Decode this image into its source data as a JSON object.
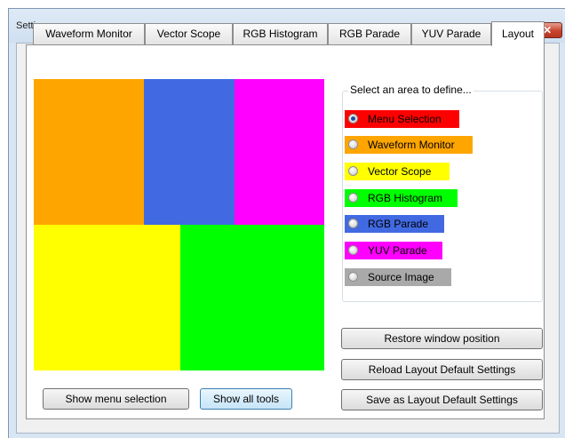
{
  "window": {
    "title": "Settings",
    "close_glyph": "✕"
  },
  "tabs": [
    {
      "label": "Waveform Monitor"
    },
    {
      "label": "Vector Scope"
    },
    {
      "label": "RGB Histogram"
    },
    {
      "label": "RGB Parade"
    },
    {
      "label": "YUV Parade"
    },
    {
      "label": "Layout",
      "active": true
    }
  ],
  "preview_colors": {
    "menu_selection": "#ff0000",
    "waveform_monitor": "#ffa500",
    "vector_scope": "#ffff00",
    "rgb_histogram": "#00ff00",
    "rgb_parade": "#4169e1",
    "yuv_parade": "#ff00ff",
    "source_image": "#a9a9a9"
  },
  "area_group": {
    "caption": "Select an area to define...",
    "options": [
      {
        "label": "Menu Selection",
        "color": "#ff0000",
        "checked": true
      },
      {
        "label": "Waveform Monitor",
        "color": "#ffa500",
        "checked": false
      },
      {
        "label": "Vector Scope",
        "color": "#ffff00",
        "checked": false
      },
      {
        "label": "RGB Histogram",
        "color": "#00ff00",
        "checked": false
      },
      {
        "label": "RGB Parade",
        "color": "#4169e1",
        "checked": false
      },
      {
        "label": "YUV Parade",
        "color": "#ff00ff",
        "checked": false
      },
      {
        "label": "Source Image",
        "color": "#a9a9a9",
        "checked": false
      }
    ]
  },
  "buttons": {
    "restore_window_position": "Restore window position",
    "reload_layout_defaults": "Reload Layout Default Settings",
    "save_layout_defaults": "Save as Layout Default Settings",
    "show_menu_selection": "Show menu selection",
    "show_all_tools": "Show all tools"
  }
}
